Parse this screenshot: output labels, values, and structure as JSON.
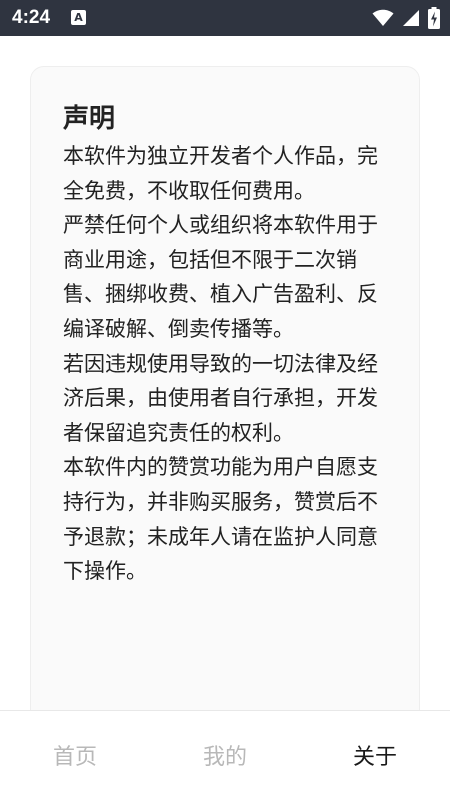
{
  "status_bar": {
    "time": "4:24",
    "notification_icon": "a-notification-icon",
    "notification_letter": "A",
    "icons": [
      "wifi-icon",
      "signal-icon",
      "battery-charging-icon"
    ],
    "background_color": "#2f3440"
  },
  "notice": {
    "title": "声明",
    "paragraphs": [
      "本软件为独立开发者个人作品，完全免费，不收取任何费用。",
      "严禁任何个人或组织将本软件用于商业用途，包括但不限于二次销售、捆绑收费、植入广告盈利、反编译破解、倒卖传播等。",
      "若因违规使用导致的一切法律及经济后果，由使用者自行承担，开发者保留追究责任的权利。",
      "本软件内的赞赏功能为用户自愿支持行为，并非购买服务，赞赏后不予退款；未成年人请在监护人同意下操作。"
    ]
  },
  "bottom_nav": {
    "tabs": [
      {
        "label": "首页",
        "active": false
      },
      {
        "label": "我的",
        "active": false
      },
      {
        "label": "关于",
        "active": true
      }
    ],
    "active_color": "#1a1a1a",
    "inactive_color": "#b8b8b8"
  }
}
